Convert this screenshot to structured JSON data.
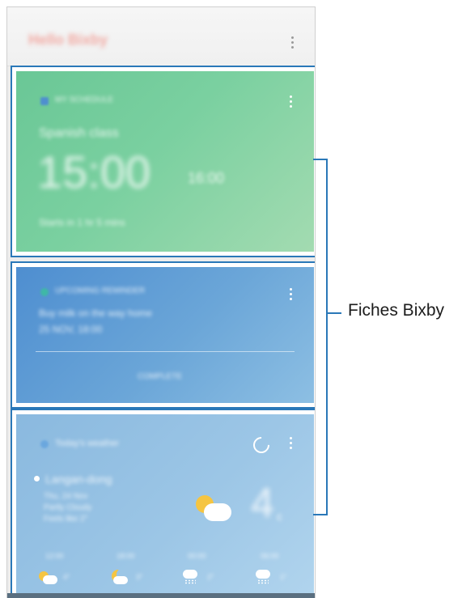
{
  "header": {
    "title": "Hello Bixby"
  },
  "cards": [
    {
      "id": "schedule",
      "header_text": "MY SCHEDULE",
      "event_title": "Spanish class",
      "big_time": "15:00",
      "end_time": "16:00",
      "footer_text": "Starts in 1 hr 5 mins",
      "background": "#6ac796"
    },
    {
      "id": "reminder",
      "header_text": "UPCOMING REMINDER",
      "line1": "Buy milk on the way home",
      "line2": "25 NOV, 18:00",
      "action": "COMPLETE",
      "background": "#5a97d3"
    },
    {
      "id": "weather",
      "header_text": "Today's weather",
      "location": "Langan-dong",
      "details": [
        "Thu, 24 Nov",
        "Partly Cloudy",
        "Feels like 2°"
      ],
      "temperature": "4",
      "unit": "c",
      "forecast": [
        {
          "time": "12:00",
          "temp": "4°",
          "icon": "sun-cloud-icon"
        },
        {
          "time": "18:00",
          "temp": "3°",
          "icon": "moon-cloud-icon"
        },
        {
          "time": "00:00",
          "temp": "2°",
          "icon": "rain-cloud-icon"
        },
        {
          "time": "06:00",
          "temp": "1°",
          "icon": "snow-cloud-icon"
        }
      ],
      "background": "#9cc6e6"
    }
  ],
  "annotation": {
    "label": "Fiches Bixby",
    "color": "#2a78b8"
  }
}
